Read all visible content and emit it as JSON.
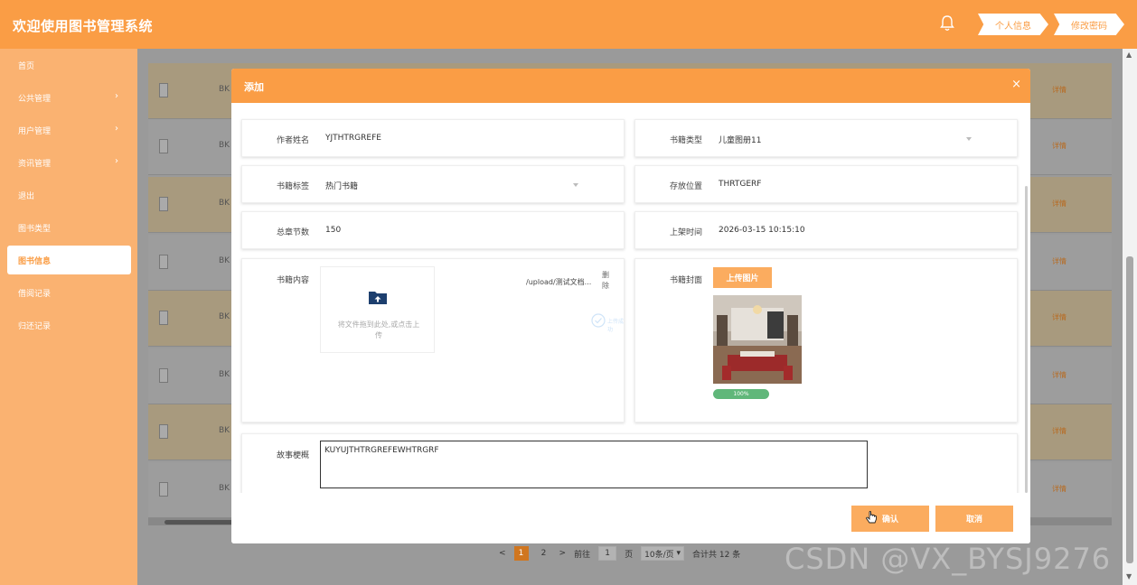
{
  "header": {
    "title": "欢迎使用图书管理系统",
    "btn_profile": "个人信息",
    "btn_password": "修改密码",
    "bell_icon": "bell-icon"
  },
  "sidebar": {
    "items": [
      {
        "label": "首页",
        "has_arrow": false
      },
      {
        "label": "公共管理",
        "has_arrow": true
      },
      {
        "label": "用户管理",
        "has_arrow": true
      },
      {
        "label": "资讯管理",
        "has_arrow": true
      },
      {
        "label": "退出",
        "has_arrow": false
      },
      {
        "label": "图书类型",
        "has_arrow": false
      },
      {
        "label": "图书信息",
        "has_arrow": false,
        "active": true
      },
      {
        "label": "借阅记录",
        "has_arrow": false
      },
      {
        "label": "归还记录",
        "has_arrow": false
      }
    ]
  },
  "background_table": {
    "row_id_prefix": "BK",
    "row_link": "详情"
  },
  "pagination": {
    "prev": "<",
    "page1": "1",
    "page2": "2",
    "next": ">",
    "goto_label": "前往",
    "goto_value": "1",
    "page_unit": "页",
    "page_size": "10条/页",
    "total": "合计共 12 条"
  },
  "watermark": "CSDN @VX_BYSJ9276",
  "modal": {
    "title": "添加",
    "close": "×",
    "fields": {
      "author_label": "作者姓名",
      "author_value": "YJTHTRGREFE",
      "book_type_label": "书籍类型",
      "book_type_value": "儿童图册11",
      "book_tag_label": "书籍标签",
      "book_tag_value": "热门书籍",
      "location_label": "存放位置",
      "location_value": "THRTGERF",
      "chapters_label": "总章节数",
      "chapters_value": "150",
      "shelf_time_label": "上架时间",
      "shelf_time_value": "2026-03-15 10:15:10",
      "content_label": "书籍内容",
      "upload_hint": "将文件拖到此处,或点击上传",
      "file_name": "/upload/测试文档...",
      "file_delete": "删除",
      "file_status": "上传成功",
      "cover_label": "书籍封面",
      "cover_button": "上传图片",
      "cover_progress": "100%",
      "cover_progress_value": 1.0,
      "synopsis_label": "故事梗概",
      "synopsis_value": "KUYUJTHTRGREFEWHTRGRF"
    },
    "confirm": "确认",
    "cancel": "取消"
  },
  "colors": {
    "brand": "#fa9d45",
    "sidebar": "#fab271",
    "button": "#fbac5f",
    "progress": "#60b77a"
  }
}
